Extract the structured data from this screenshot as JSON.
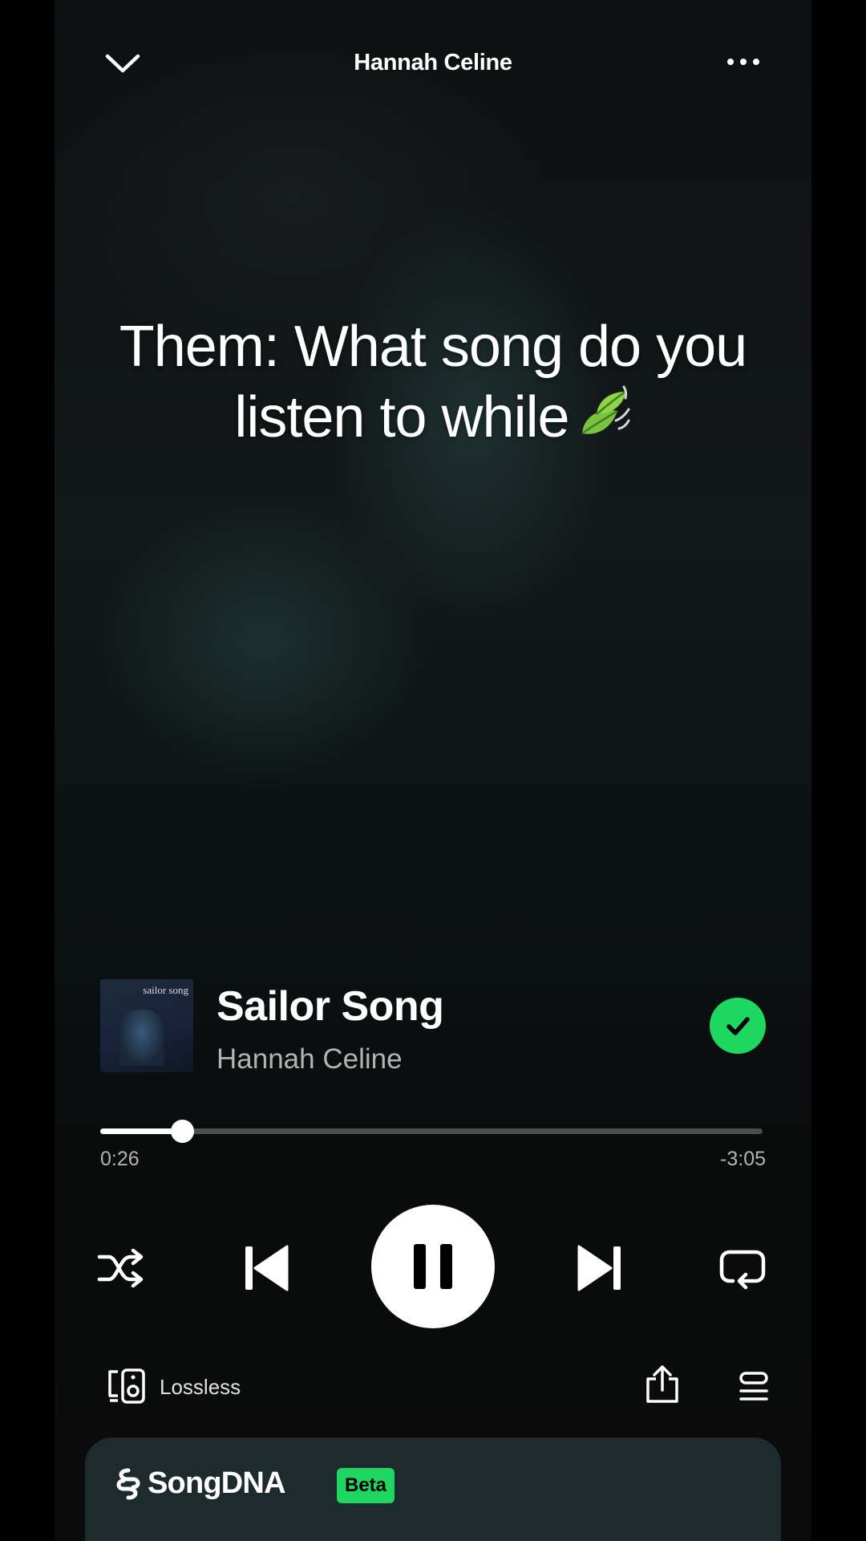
{
  "header": {
    "title": "Hannah Celine"
  },
  "caption": {
    "line1": "Them: What song do you",
    "line2": "listen to while",
    "emoji_icon": "leaf-fluttering-in-wind-icon"
  },
  "track": {
    "album_art_text": "sailor song",
    "title": "Sailor Song",
    "artist": "Hannah Celine",
    "saved": true
  },
  "progress": {
    "elapsed": "0:26",
    "remaining": "-3:05",
    "fraction": 0.123
  },
  "controls": {
    "shuffle_icon": "shuffle-icon",
    "previous_icon": "skip-previous-icon",
    "play_state": "playing",
    "next_icon": "skip-next-icon",
    "repeat_icon": "repeat-icon"
  },
  "footer": {
    "device_icon": "connect-device-icon",
    "quality_label": "Lossless",
    "share_icon": "share-icon",
    "queue_icon": "queue-icon"
  },
  "songdna": {
    "label": "SongDNA",
    "badge": "Beta"
  },
  "colors": {
    "accent_green": "#1ed760",
    "card_bg": "#1d2b2f",
    "secondary_text": "#b3b3b3"
  }
}
